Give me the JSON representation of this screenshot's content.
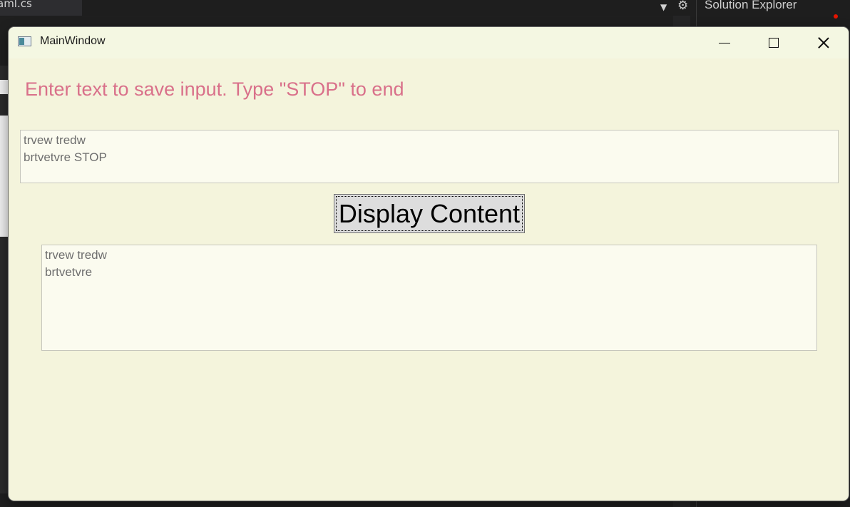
{
  "ide": {
    "tab_label": "aml.cs",
    "panel_title": "Solution Explorer"
  },
  "window": {
    "title": "MainWindow",
    "heading": "Enter text to save input. Type \"STOP\" to end",
    "input_value": "trvew tredw\nbrtvetvre STOP",
    "button_label": "Display Content",
    "output_value": "trvew tredw\nbrtvetvre"
  },
  "colors": {
    "window_bg": "#f4f4dc",
    "heading": "#d9708a",
    "button_bg": "#dddddd"
  }
}
